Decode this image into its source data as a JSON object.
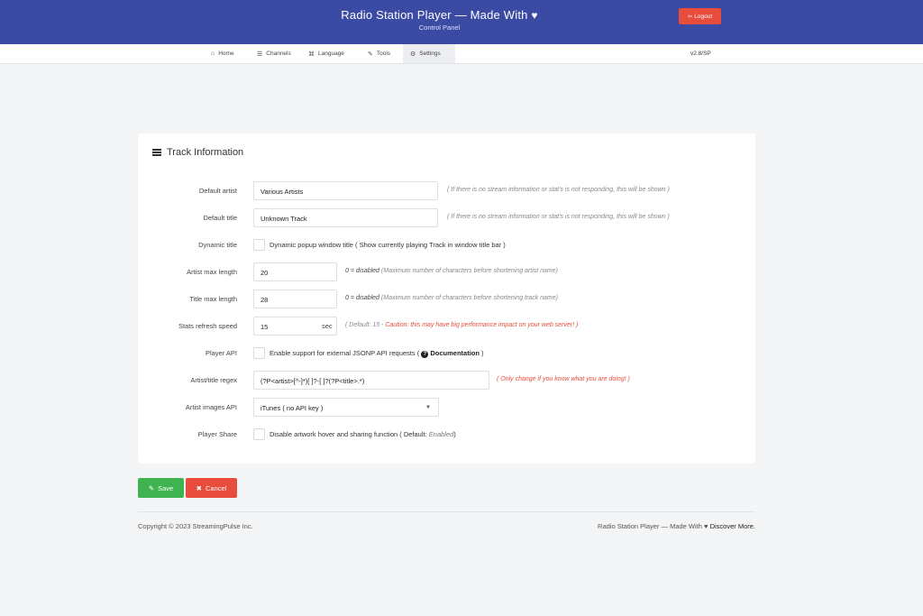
{
  "header": {
    "title": "Radio Station Player — Made With",
    "heart": "♥",
    "subtitle": "Control Panel",
    "logout_label": "Logout"
  },
  "nav": {
    "items": [
      {
        "label": "Home",
        "icon": "home-icon"
      },
      {
        "label": "Channels",
        "icon": "channels-icon"
      },
      {
        "label": "Language",
        "icon": "language-icon"
      },
      {
        "label": "Tools",
        "icon": "wrench-icon"
      },
      {
        "label": "Settings",
        "icon": "cogs-icon",
        "active": true
      }
    ],
    "version": "v2.8/SP"
  },
  "card": {
    "title": "Track Information",
    "fields": {
      "default_artist": {
        "label": "Default artist",
        "value": "Various Artists",
        "hint": "( If there is no stream information or stat's is not responding, this will be shown )"
      },
      "default_title": {
        "label": "Default title",
        "value": "Unknown Track",
        "hint": "( If there is no stream information or stat's is not responding, this will be shown )"
      },
      "dynamic_title": {
        "label": "Dynamic title",
        "checkbox_label": "Dynamic popup window title ( Show currently playing Track in window title bar )"
      },
      "artist_max": {
        "label": "Artist max length",
        "value": "20",
        "hint_prefix": "0 = disabled",
        "hint": "(Maximum number of characters before shortening artist name)"
      },
      "title_max": {
        "label": "Title max length",
        "value": "28",
        "hint_prefix": "0 = disabled",
        "hint": "(Maximum number of characters before shortening track name)"
      },
      "stats_refresh": {
        "label": "Stats refresh speed",
        "value": "15",
        "suffix": "sec",
        "hint_default": "( Default: 15 - ",
        "hint_caution": "Caution: this may have big performance impact on your web server! )"
      },
      "player_api": {
        "label": "Player API",
        "checkbox_label_pre": "Enable support for external JSONP API requests (",
        "doc_icon": "question-circle-icon",
        "doc_label": "Documentation",
        "checkbox_label_post": ")"
      },
      "regex": {
        "label": "Artist/title regex",
        "value": "(?P<artist>[^-]*)[ ]?-[ ]?(?P<title>.*)",
        "hint": "( Only change if you know what you are doing! )"
      },
      "images_api": {
        "label": "Artist images API",
        "selected": "iTunes ( no API key )"
      },
      "player_share": {
        "label": "Player Share",
        "checkbox_label_pre": "Disable artwork hover and sharing function ( Default:",
        "default_value": "Enabled",
        "checkbox_label_post": ")"
      }
    }
  },
  "actions": {
    "save_label": "Save",
    "cancel_label": "Cancel"
  },
  "footer": {
    "copyright": "Copyright © 2023 StreamingPulse Inc.",
    "right_text": "Radio Station Player — Made With",
    "right_heart": "♥",
    "discover": "Discover More."
  },
  "colors": {
    "header": "#3b4aa3",
    "danger": "#e74c3c",
    "success": "#3fb34f"
  }
}
